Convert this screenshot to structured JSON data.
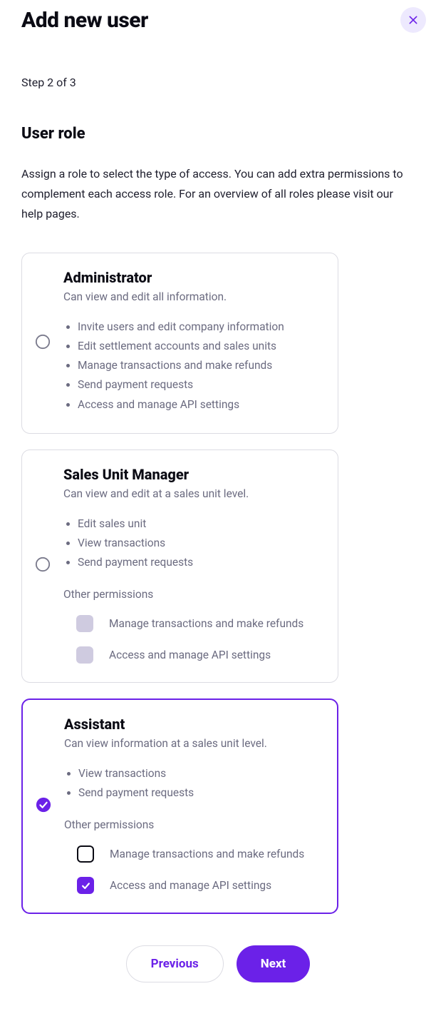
{
  "header": {
    "title": "Add new user"
  },
  "step_text": "Step 2 of 3",
  "section": {
    "title": "User role",
    "description": "Assign a role to select the type of access. You can add extra permissions to complement each access role. For an overview of all roles please visit our help pages."
  },
  "roles": {
    "admin": {
      "title": "Administrator",
      "subtitle": "Can view and edit all information.",
      "bullets": [
        "Invite users and edit company information",
        "Edit settlement accounts and sales units",
        "Manage transactions and make refunds",
        "Send payment requests",
        "Access and manage API settings"
      ]
    },
    "sum": {
      "title": "Sales Unit Manager",
      "subtitle": "Can view and edit at a sales unit level.",
      "bullets": [
        "Edit sales unit",
        "View transactions",
        "Send payment requests"
      ],
      "other_label": "Other permissions",
      "perms": [
        "Manage transactions and make refunds",
        "Access and manage API settings"
      ]
    },
    "assistant": {
      "title": "Assistant",
      "subtitle": "Can view information at a sales unit level.",
      "bullets": [
        "View transactions",
        "Send payment requests"
      ],
      "other_label": "Other permissions",
      "perms": [
        "Manage transactions and make refunds",
        "Access and manage API settings"
      ]
    }
  },
  "footer": {
    "prev": "Previous",
    "next": "Next"
  }
}
